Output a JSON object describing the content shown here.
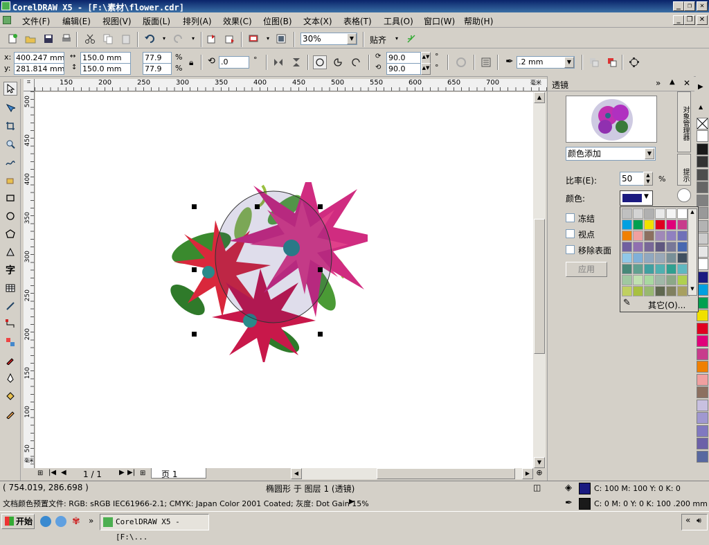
{
  "window": {
    "title": "CorelDRAW X5 - [F:\\素材\\flower.cdr]"
  },
  "menu": [
    "文件(F)",
    "编辑(E)",
    "视图(V)",
    "版面(L)",
    "排列(A)",
    "效果(C)",
    "位图(B)",
    "文本(X)",
    "表格(T)",
    "工具(O)",
    "窗口(W)",
    "帮助(H)"
  ],
  "toolbar": {
    "zoom": "30%",
    "snap_label": "贴齐"
  },
  "propbar": {
    "x_label": "x:",
    "x": "400.247 mm",
    "y_label": "y:",
    "y": "281.814 mm",
    "width": "150.0 mm",
    "height": "150.0 mm",
    "scale_w": "77.9",
    "scale_h": "77.9",
    "pct": "%",
    "rotation": ".0",
    "deg": "°",
    "angle1": "90.0",
    "angle2": "90.0",
    "outline_width": ".2 mm"
  },
  "rulers": {
    "h_ticks": [
      "150",
      "200",
      "250",
      "300",
      "350",
      "400",
      "450",
      "500",
      "550",
      "600",
      "650",
      "700"
    ],
    "h_unit": "毫米",
    "v_ticks": [
      "500",
      "450",
      "400",
      "350",
      "300",
      "250",
      "200",
      "150",
      "100",
      "50"
    ],
    "v_unit": "毫米"
  },
  "pagebar": {
    "page_count": "1 / 1",
    "page_tab": "页 1"
  },
  "docker": {
    "title": "透镜",
    "lens_type": "颜色添加",
    "rate_label": "比率(E):",
    "rate_value": "50",
    "rate_unit": "%",
    "color_label": "颜色:",
    "color_value": "#1a1a80",
    "freeze_label": "冻结",
    "viewpoint_label": "视点",
    "remove_face_label": "移除表面",
    "apply_label": "应用",
    "side_tab1": "对象管理器",
    "side_tab2": "提示"
  },
  "color_picker": {
    "other_label": "其它(O)...",
    "colors": [
      "#c0c0c0",
      "#d4d4d4",
      "#b0b0b0",
      "#e8e8e8",
      "#f4f4f4",
      "#ffffff",
      "#1a1a80",
      "#00a0e0",
      "#00a050",
      "#f0e000",
      "#e00020",
      "#e0007a",
      "#c83c8c",
      "#a0a0a0",
      "#f08000",
      "#f0a0a0",
      "#8c7060",
      "#a088b8",
      "#9080c0",
      "#7070b8",
      "#5a8ccc",
      "#7060a0",
      "#9070b0",
      "#786898",
      "#605880",
      "#787898",
      "#4868b0",
      "#2090d0",
      "#90c8e8",
      "#80b0d8",
      "#90a8c0",
      "#98a8b8",
      "#789098",
      "#405060",
      "#486878",
      "#488878",
      "#60a090",
      "#40a0a0",
      "#50b0b0",
      "#30a090",
      "#60b8c0",
      "#70c0c8",
      "#a0c8a0",
      "#c0e0b0",
      "#a8d8a0",
      "#a0b8a8",
      "#8ca888",
      "#b0d050",
      "#d0e050",
      "#c0d060",
      "#a8c040",
      "#98b870",
      "#606850",
      "#808060",
      "#a8a060",
      "#c0c080"
    ]
  },
  "palette_colors": [
    "#ffffff",
    "#1a1a1a",
    "#333333",
    "#4d4d4d",
    "#666666",
    "#808080",
    "#999999",
    "#b3b3b3",
    "#cccccc",
    "#e6e6e6",
    "#ffffff",
    "#1a1a80",
    "#00a0e0",
    "#00a050",
    "#f0e000",
    "#e00020",
    "#e0007a",
    "#c83c8c",
    "#f08000",
    "#f0a0a0",
    "#8c7060",
    "#c8c0e0",
    "#a098d0",
    "#8078c0",
    "#6c60a8",
    "#5868a0"
  ],
  "status": {
    "coords": "( 754.019, 286.698 )",
    "object": "椭圆形 于 图层 1 (透镜)",
    "fill_info": "C: 100 M: 100 Y: 0 K: 0",
    "outline_info": "C: 0 M: 0 Y: 0 K: 100  .200 mm",
    "profile": "文档颜色预置文件: RGB: sRGB IEC61966-2.1; CMYK: Japan Color 2001 Coated; 灰度: Dot Gain 15%"
  },
  "taskbar": {
    "start": "开始",
    "task": "CorelDRAW X5 - [F:\\..."
  }
}
